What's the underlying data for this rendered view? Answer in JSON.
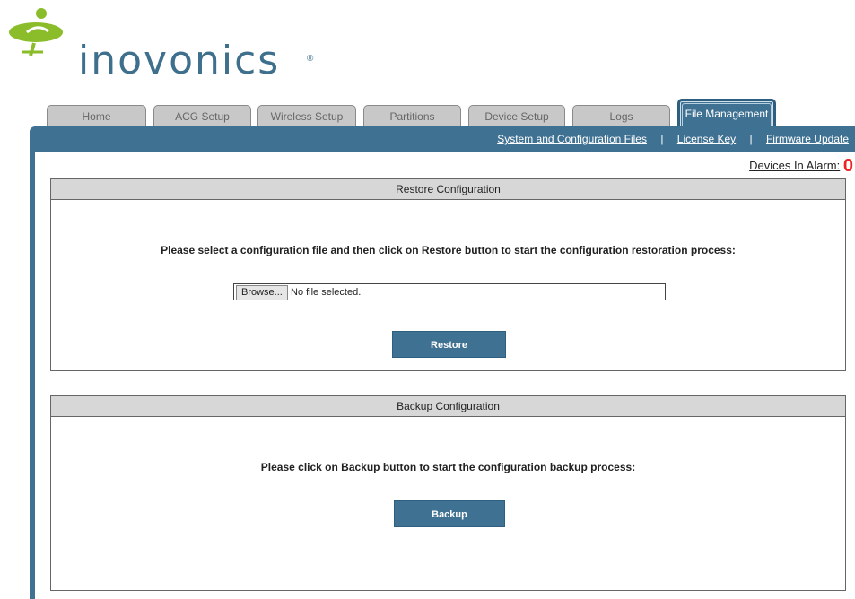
{
  "brand": {
    "name": "inovonics",
    "registered": "®",
    "colors": {
      "green": "#8bbd2a",
      "blue": "#3e6f8c"
    }
  },
  "tabs": [
    {
      "label": "Home",
      "active": false
    },
    {
      "label": "ACG Setup",
      "active": false
    },
    {
      "label": "Wireless Setup",
      "active": false
    },
    {
      "label": "Partitions",
      "active": false
    },
    {
      "label": "Device Setup",
      "active": false
    },
    {
      "label": "Logs",
      "active": false
    },
    {
      "label": "File Management",
      "active": true
    }
  ],
  "subnav": {
    "system_files": "System and Configuration Files",
    "license_key": "License Key",
    "firmware_update": "Firmware Update",
    "separator": "|"
  },
  "alarm": {
    "label": "Devices In Alarm:",
    "count": "0"
  },
  "restore": {
    "title": "Restore Configuration",
    "instruction": "Please select a configuration file and then click on Restore button to start the configuration restoration process:",
    "browse_label": "Browse...",
    "file_status": "No file selected.",
    "button_label": "Restore"
  },
  "backup": {
    "title": "Backup Configuration",
    "instruction": "Please click on Backup button to start the configuration backup process:",
    "button_label": "Backup"
  },
  "theme": {
    "accent": "#3f7193",
    "panel_header": "#d7d7d7",
    "alarm_color": "#e22222"
  }
}
